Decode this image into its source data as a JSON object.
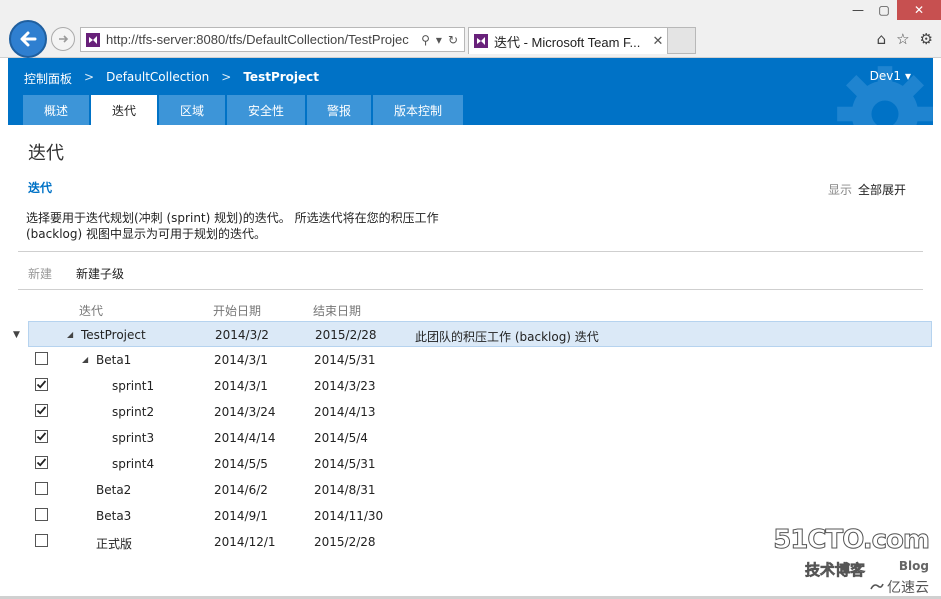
{
  "browser": {
    "url": "http://tfs-server:8080/tfs/DefaultCollection/TestProjec",
    "tab_title": "迭代 - Microsoft Team F..."
  },
  "header": {
    "breadcrumb": [
      "控制面板",
      "DefaultCollection",
      "TestProject"
    ],
    "user": "Dev1",
    "tabs": [
      {
        "label": "概述",
        "active": false
      },
      {
        "label": "迭代",
        "active": true
      },
      {
        "label": "区域",
        "active": false
      },
      {
        "label": "安全性",
        "active": false
      },
      {
        "label": "警报",
        "active": false
      },
      {
        "label": "版本控制",
        "active": false
      }
    ]
  },
  "content": {
    "page_title": "迭代",
    "section_title": "迭代",
    "show_label": "显示",
    "show_value": "全部展开",
    "description_line1": "选择要用于迭代规划(冲刺 (sprint) 规划)的迭代。 所选迭代将在您的积压工作",
    "description_line2": "(backlog) 视图中显示为可用于规划的迭代。",
    "toolbar": {
      "new": "新建",
      "new_child": "新建子级"
    },
    "columns": {
      "iteration": "迭代",
      "start": "开始日期",
      "end": "结束日期"
    },
    "rows": [
      {
        "name": "TestProject",
        "start": "2014/3/2",
        "end": "2015/2/28",
        "note": "此团队的积压工作 (backlog) 迭代",
        "checked": null,
        "level": 0,
        "expander": true
      },
      {
        "name": "Beta1",
        "start": "2014/3/1",
        "end": "2014/5/31",
        "note": "",
        "checked": false,
        "level": 1,
        "expander": true
      },
      {
        "name": "sprint1",
        "start": "2014/3/1",
        "end": "2014/3/23",
        "note": "",
        "checked": true,
        "level": 2,
        "expander": false
      },
      {
        "name": "sprint2",
        "start": "2014/3/24",
        "end": "2014/4/13",
        "note": "",
        "checked": true,
        "level": 2,
        "expander": false
      },
      {
        "name": "sprint3",
        "start": "2014/4/14",
        "end": "2014/5/4",
        "note": "",
        "checked": true,
        "level": 2,
        "expander": false
      },
      {
        "name": "sprint4",
        "start": "2014/5/5",
        "end": "2014/5/31",
        "note": "",
        "checked": true,
        "level": 2,
        "expander": false
      },
      {
        "name": "Beta2",
        "start": "2014/6/2",
        "end": "2014/8/31",
        "note": "",
        "checked": false,
        "level": 1,
        "expander": false
      },
      {
        "name": "Beta3",
        "start": "2014/9/1",
        "end": "2014/11/30",
        "note": "",
        "checked": false,
        "level": 1,
        "expander": false
      },
      {
        "name": "正式版",
        "start": "2014/12/1",
        "end": "2015/2/28",
        "note": "",
        "checked": false,
        "level": 1,
        "expander": false
      }
    ]
  },
  "watermark": {
    "logo": "51CTO.com",
    "sub": "技术博客",
    "blog": "Blog",
    "yisu": "亿速云"
  },
  "colors": {
    "header_blue": "#0072c6",
    "tab_blue": "#3d95d8",
    "selected_row": "#dbe9f7"
  }
}
